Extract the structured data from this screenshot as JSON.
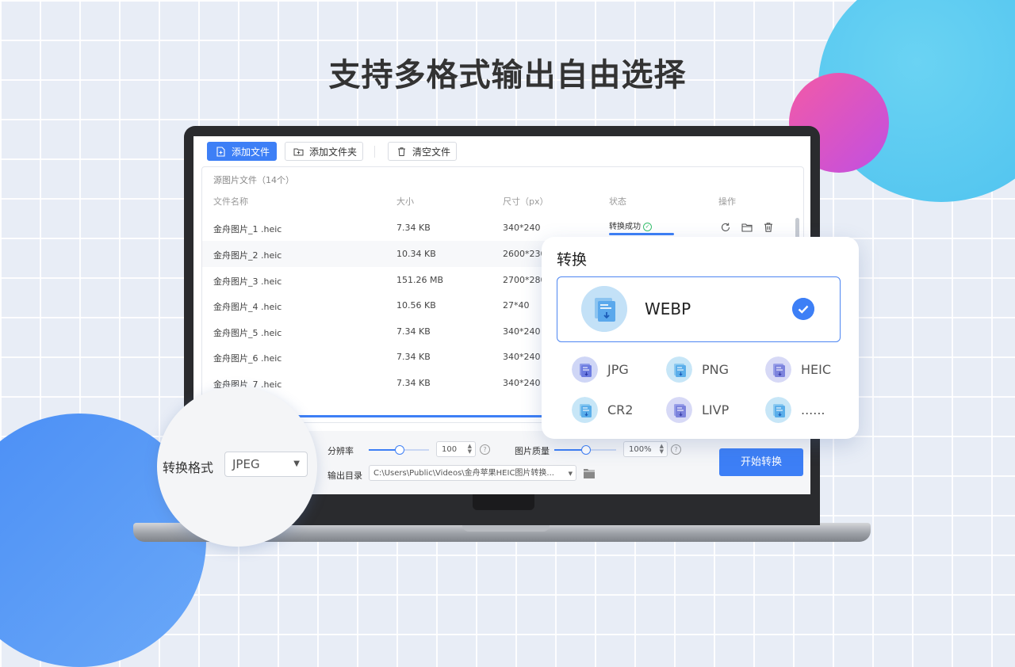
{
  "headline": "支持多格式输出自由选择",
  "toolbar": {
    "add_file": "添加文件",
    "add_folder": "添加文件夹",
    "clear_files": "清空文件"
  },
  "file_panel": {
    "title": "源图片文件（14个）",
    "columns": [
      "文件名称",
      "大小",
      "尺寸（px）",
      "状态",
      "操作"
    ],
    "rows": [
      {
        "name": "金舟图片_1 .heic",
        "size": "7.34 KB",
        "dims": "340*240",
        "status": "转换成功"
      },
      {
        "name": "金舟图片_2 .heic",
        "size": "10.34 KB",
        "dims": "2600*230"
      },
      {
        "name": "金舟图片_3 .heic",
        "size": "151.26 MB",
        "dims": "2700*280"
      },
      {
        "name": "金舟图片_4 .heic",
        "size": "10.56 KB",
        "dims": "27*40"
      },
      {
        "name": "金舟图片_5 .heic",
        "size": "7.34 KB",
        "dims": "340*240"
      },
      {
        "name": "金舟图片_6 .heic",
        "size": "7.34 KB",
        "dims": "340*240"
      },
      {
        "name": "金舟图片_7 .heic",
        "size": "7.34 KB",
        "dims": "340*240"
      }
    ],
    "row_actions": [
      "refresh-icon",
      "folder-icon",
      "trash-icon"
    ]
  },
  "bottom_bar": {
    "resolution_label": "分辨率",
    "resolution_value": "100",
    "resolution_level": 0.5,
    "quality_label": "图片质量",
    "quality_value": "100%",
    "quality_level": 0.5,
    "output_dir_label": "输出目录",
    "output_dir_value": "C:\\Users\\Public\\Videos\\金舟苹果HEIC图片转换...",
    "start_button": "开始转换"
  },
  "format_selector": {
    "label": "转换格式",
    "value": "JPEG"
  },
  "convert_popup": {
    "title": "转换",
    "selected": "WEBP",
    "options": [
      "JPG",
      "PNG",
      "HEIC",
      "CR2",
      "LIVP",
      "......"
    ]
  },
  "colors": {
    "accent": "#3d7ff6",
    "success": "#38c06e",
    "background": "#e8edf6"
  }
}
